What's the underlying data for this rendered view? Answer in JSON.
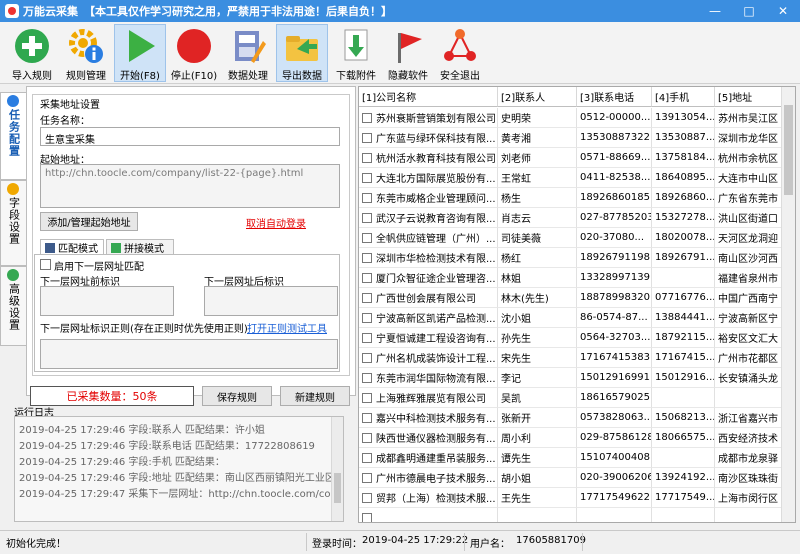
{
  "window": {
    "title": "万能云采集",
    "subtitle": "【本工具仅作学习研究之用，严禁用于非法用途！后果自负！】"
  },
  "toolbar": [
    {
      "label": "导入规则",
      "icon": "plus-circle-icon"
    },
    {
      "label": "规则管理",
      "icon": "gear-info-icon"
    },
    {
      "label": "开始(F8)",
      "icon": "play-icon"
    },
    {
      "label": "停止(F10)",
      "icon": "stop-icon"
    },
    {
      "label": "数据处理",
      "icon": "database-edit-icon"
    },
    {
      "label": "导出数据",
      "icon": "folder-export-icon"
    },
    {
      "label": "下载附件",
      "icon": "download-file-icon"
    },
    {
      "label": "隐藏软件",
      "icon": "red-flag-icon"
    },
    {
      "label": "安全退出",
      "icon": "network-exit-icon"
    }
  ],
  "vtabs": [
    "任务配置",
    "字段设置",
    "高级设置"
  ],
  "task": {
    "group_title": "采集地址设置",
    "name_label": "任务名称：",
    "name_value": "生意宝采集",
    "start_url_label": "起始地址：",
    "start_url_value": "http://chn.toocle.com/company/list-22-{page}.html",
    "add_url_button": "添加/管理起始地址",
    "cancel_login_link": "取消自动登录"
  },
  "match": {
    "tab_match": "匹配模式",
    "tab_join": "拼接模式",
    "enable_next_label": "启用下一层网址匹配",
    "prefix_label": "下一层网址前标识",
    "suffix_label": "下一层网址后标识",
    "regex_label": "下一层网址标识正则(存在正则时优先使用正则)",
    "regex_link": "打开正则测试工具"
  },
  "actions": {
    "count_text": "已采集数量：50条",
    "save_rule": "保存规则",
    "new_rule": "新建规则"
  },
  "log": {
    "title": "运行日志",
    "lines": [
      "2019-04-25 17:29:46 字段:联系人 匹配结果：许小姐",
      "2019-04-25 17:29:46 字段:联系电话 匹配结果：17722808619",
      "2019-04-25 17:29:46 字段:手机 匹配结果：",
      "2019-04-25 17:29:46 字段:地址 匹配结果：南山区西丽镇阳光工业区创益",
      "2019-04-25 17:29:47 采集下一层网址：http://chn.toocle.com/compan"
    ]
  },
  "grid": {
    "columns": [
      "[1]公司名称",
      "[2]联系人",
      "[3]联系电话",
      "[4]手机",
      "[5]地址"
    ],
    "rows": [
      [
        "苏州衰斯营销策划有限公司",
        "史明荣",
        "0512-00000...",
        "13913054...",
        "苏州市吴江区"
      ],
      [
        "广东蓝与绿环保科技有限...",
        "黄考湘",
        "13530887322",
        "13530887...",
        "深圳市龙华区"
      ],
      [
        "杭州活水教育科技有限公司",
        "刘老师",
        "0571-88669...",
        "13758184...",
        "杭州市余杭区"
      ],
      [
        "大连北方国际展览股份有...",
        "王常虹",
        "0411-82538...",
        "18640895...",
        "大连市中山区"
      ],
      [
        "东莞市威格企业管理顾问...",
        "杨生",
        "18926860185",
        "18926860...",
        "广东省东莞市"
      ],
      [
        "武汉子云说教育咨询有限...",
        "肖志云",
        "027-87785203",
        "15327278...",
        "洪山区街道口"
      ],
      [
        "全帆供应链管理（广州）...",
        "司徒美薇",
        "020-37080...",
        "18020078...",
        "天河区龙洞迎"
      ],
      [
        "深圳市华检检测技术有限...",
        "杨红",
        "18926791198",
        "18926791...",
        "南山区沙河西"
      ],
      [
        "厦门众智征途企业管理咨...",
        "林姐",
        "13328997139",
        "",
        "福建省泉州市"
      ],
      [
        "广西世创会展有限公司",
        "林木(先生)",
        "18878998320",
        "07716776...",
        "中国广西南宁"
      ],
      [
        "宁波高新区凯诺产品检测...",
        "沈小姐",
        "86-0574-87...",
        "13884441...",
        "宁波高新区宁"
      ],
      [
        "宁夏恒诚建工程设咨询有...",
        "孙先生",
        "0564-32703...",
        "18792115...",
        "裕安区文汇大"
      ],
      [
        "广州名机成装饰设计工程...",
        "宋先生",
        "17167415383",
        "17167415...",
        "广州市花都区"
      ],
      [
        "东莞市润华国际物流有限...",
        "李记",
        "15012916991",
        "15012916...",
        "长安镇涌头龙"
      ],
      [
        "上海雅辉雅展览有限公司",
        "吴凯",
        "18616579025",
        "",
        ""
      ],
      [
        "嘉兴中科检测技术服务有...",
        "张新开",
        "0573828063...",
        "15068213...",
        "浙江省嘉兴市"
      ],
      [
        "陕西世通仪器检测服务有...",
        "周小利",
        "029-87586128",
        "18066575...",
        "西安经济技术"
      ],
      [
        "成都鑫明通建重吊装服务...",
        "谭先生",
        "15107400408",
        "",
        "成都市龙泉驿"
      ],
      [
        "广州市德晨电子技术服务...",
        "胡小姐",
        "020-39006206",
        "13924192...",
        "南沙区珠珠街"
      ],
      [
        "贸邦（上海）检测技术服...",
        "王先生",
        "17717549622",
        "17717549...",
        "上海市闵行区"
      ],
      [
        "",
        "",
        "",
        "",
        ""
      ]
    ]
  },
  "status": {
    "ready": "初始化完成！",
    "login_time_label": "登录时间：",
    "login_time_value": "2019-04-25 17:29:22",
    "user_label": "用户名：",
    "user_value": "17605881709"
  }
}
